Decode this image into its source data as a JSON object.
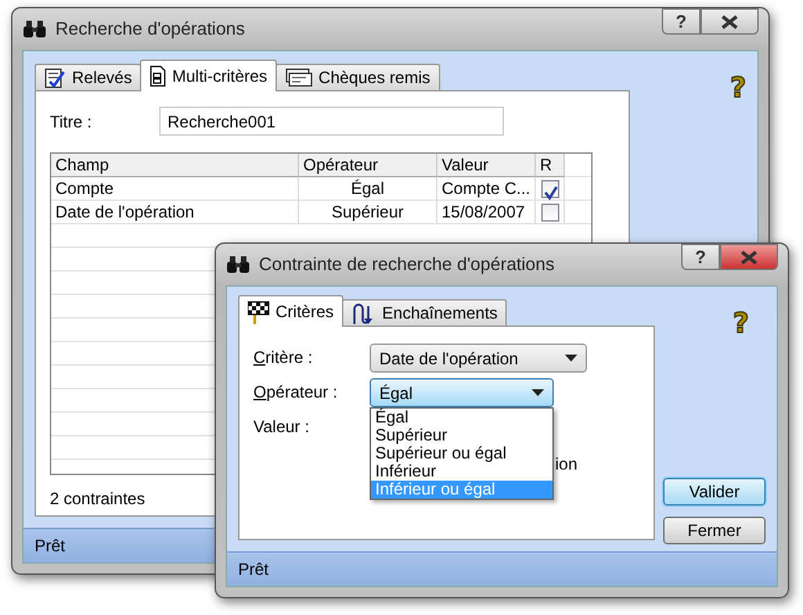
{
  "main_window": {
    "title": "Recherche d'opérations",
    "title_buttons": {
      "help": "?"
    },
    "tabs": [
      {
        "label": "Relevés",
        "selected": false
      },
      {
        "label": "Multi-critères",
        "selected": true
      },
      {
        "label": "Chèques remis",
        "selected": false
      }
    ],
    "help_mark": "?",
    "titre": {
      "label": "Titre :",
      "value": "Recherche001"
    },
    "table": {
      "columns": [
        "Champ",
        "Opérateur",
        "Valeur",
        "R"
      ],
      "rows": [
        {
          "champ": "Compte",
          "operateur": "Égal",
          "valeur": "Compte C...",
          "checked": true
        },
        {
          "champ": "Date de l'opération",
          "operateur": "Supérieur",
          "valeur": "15/08/2007",
          "checked": false
        }
      ]
    },
    "count": "2 contraintes",
    "status_bar": "Prêt"
  },
  "dialog": {
    "title": "Contrainte de recherche d'opérations",
    "title_buttons": {
      "help": "?"
    },
    "tabs": [
      {
        "label": "Critères",
        "selected": true
      },
      {
        "label": "Enchaînements",
        "selected": false
      }
    ],
    "help_mark": "?",
    "fields": [
      {
        "label": "Critère :",
        "mnemonic": true,
        "value": "Date de l'opération",
        "focused": false
      },
      {
        "label": "Opérateur :",
        "mnemonic": true,
        "value": "Égal",
        "focused": true
      },
      {
        "label": "Valeur :",
        "mnemonic": false
      }
    ],
    "dropdown": [
      {
        "label": "Égal",
        "selected": false
      },
      {
        "label": "Supérieur",
        "selected": false
      },
      {
        "label": "Supérieur ou égal",
        "selected": false
      },
      {
        "label": "Inférieur",
        "selected": false
      },
      {
        "label": "Inférieur ou égal",
        "selected": true
      }
    ],
    "hidden_option_fragment": "ion",
    "buttons": [
      {
        "label": "Valider",
        "default": true
      },
      {
        "label": "Fermer",
        "default": false
      }
    ],
    "status_bar": "Prêt"
  }
}
